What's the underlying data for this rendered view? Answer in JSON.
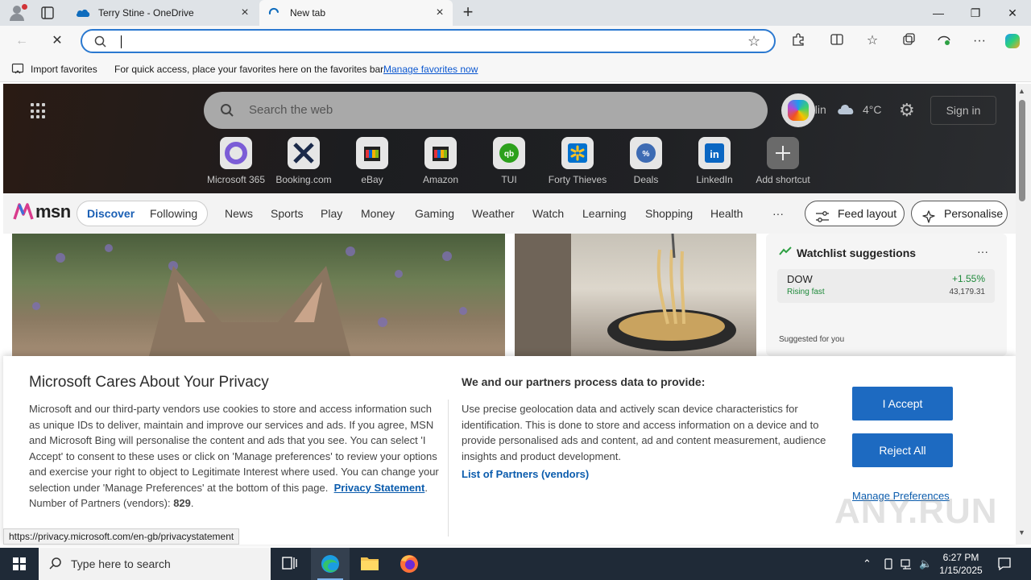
{
  "browser": {
    "tabs": [
      {
        "label": "Terry Stine - OneDrive",
        "active": false
      },
      {
        "label": "New tab",
        "active": true
      }
    ],
    "window_controls": {
      "minimize": "—",
      "restore": "❐",
      "close": "✕"
    },
    "address_value": "",
    "favbar": {
      "import_label": "Import favorites",
      "message": "For quick access, place your favorites here on the favorites bar.",
      "manage_link": "Manage favorites now"
    },
    "status_url": "https://privacy.microsoft.com/en-gb/privacystatement"
  },
  "newtab": {
    "search_placeholder": "Search the web",
    "weather_city": "Berlin",
    "weather_temp": "4°C",
    "sign_in": "Sign in",
    "shortcuts": [
      {
        "label": "Microsoft 365",
        "icon": "microsoft-365-icon"
      },
      {
        "label": "Booking.com",
        "icon": "booking-icon"
      },
      {
        "label": "eBay",
        "icon": "ebay-icon"
      },
      {
        "label": "Amazon",
        "icon": "amazon-icon"
      },
      {
        "label": "TUI",
        "icon": "tui-icon"
      },
      {
        "label": "Forty Thieves",
        "icon": "forty-thieves-icon"
      },
      {
        "label": "Deals",
        "icon": "deals-icon"
      },
      {
        "label": "LinkedIn",
        "icon": "linkedin-icon"
      },
      {
        "label": "Add shortcut",
        "icon": "plus-icon"
      }
    ]
  },
  "msn": {
    "logo_text": "msn",
    "pill": {
      "discover": "Discover",
      "following": "Following"
    },
    "nav": [
      "News",
      "Sports",
      "Play",
      "Money",
      "Gaming",
      "Weather",
      "Watch",
      "Learning",
      "Shopping",
      "Health"
    ],
    "more": "···",
    "feed_layout": "Feed layout",
    "personalise": "Personalise",
    "watchlist": {
      "title": "Watchlist suggestions",
      "more": "···",
      "stock": {
        "name": "DOW",
        "change": "+1.55%",
        "status": "Rising fast",
        "price": "43,179.31"
      },
      "suggested": "Suggested for you"
    }
  },
  "privacy": {
    "title": "Microsoft Cares About Your Privacy",
    "body": "Microsoft and our third-party vendors use cookies to store and access information such as unique IDs to deliver, maintain and improve our services and ads. If you agree, MSN and Microsoft Bing will personalise the content and ads that you see. You can select 'I Accept' to consent to these uses or click on 'Manage preferences' to review your options and exercise your right to object to Legitimate Interest where used.  You can change your selection under 'Manage Preferences' at the bottom of this page.",
    "statement_link": "Privacy Statement",
    "partners_label": "Number of Partners (vendors):",
    "partners_count": "829",
    "heading2": "We and our partners process data to provide:",
    "body2": "Use precise geolocation data and actively scan device characteristics for identification. This is done to store and access information on a device and to provide personalised ads and content, ad and content measurement, audience insights and product development.",
    "partners_link": "List of Partners (vendors)",
    "accept": "I Accept",
    "reject": "Reject All",
    "manage": "Manage Preferences"
  },
  "watermark": "ANY.RUN",
  "taskbar": {
    "search_placeholder": "Type here to search",
    "time": "6:27 PM",
    "date": "1/15/2025"
  },
  "colors": {
    "accent": "#1d6ac1",
    "link": "#0b5cad",
    "address_border": "#2b79d0",
    "taskbar": "#1f2a37"
  }
}
